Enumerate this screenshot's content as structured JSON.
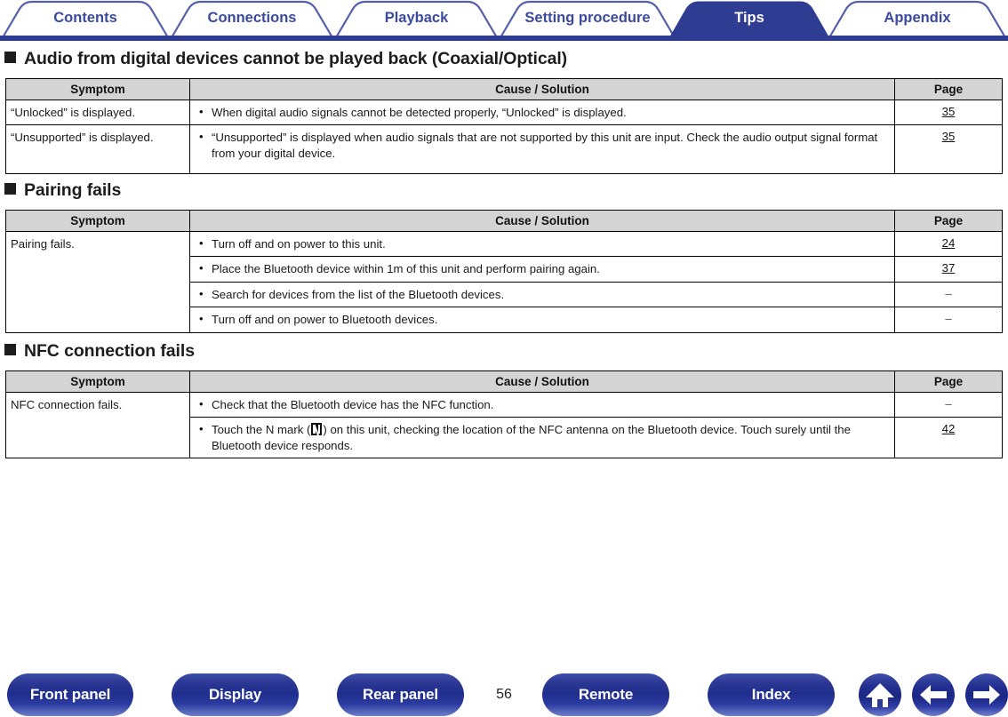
{
  "tabs": [
    {
      "label": "Contents",
      "active": false
    },
    {
      "label": "Connections",
      "active": false
    },
    {
      "label": "Playback",
      "active": false
    },
    {
      "label": "Setting procedure",
      "active": false
    },
    {
      "label": "Tips",
      "active": true
    },
    {
      "label": "Appendix",
      "active": false
    }
  ],
  "columns": {
    "symptom": "Symptom",
    "cause": "Cause / Solution",
    "page": "Page"
  },
  "sections": [
    {
      "heading": "Audio from digital devices cannot be played back (Coaxial/Optical)",
      "rows": [
        {
          "symptom": "“Unlocked” is displayed.",
          "causes": [
            {
              "text": "When digital audio signals cannot be detected properly, “Unlocked” is displayed.",
              "page": "35"
            }
          ]
        },
        {
          "symptom": "“Unsupported” is displayed.",
          "causes": [
            {
              "text": "“Unsupported” is displayed when audio signals that are not supported by this unit are input. Check the audio output signal format from your digital device.",
              "page": "35"
            }
          ]
        }
      ]
    },
    {
      "heading": "Pairing fails",
      "rows": [
        {
          "symptom": "Pairing fails.",
          "causes": [
            {
              "text": "Turn off and on power to this unit.",
              "page": "24"
            },
            {
              "text": "Place the Bluetooth device within 1m of this unit and perform pairing again.",
              "page": "37"
            },
            {
              "text": "Search for devices from the list of the Bluetooth devices.",
              "page": "–"
            },
            {
              "text": "Turn off and on power to Bluetooth devices.",
              "page": "–"
            }
          ]
        }
      ]
    },
    {
      "heading": "NFC connection fails",
      "rows": [
        {
          "symptom": "NFC connection fails.",
          "causes": [
            {
              "text": "Check that the Bluetooth device has the NFC function.",
              "page": "–"
            },
            {
              "text_before_nmark": "Touch the N mark (",
              "text_after_nmark": ") on this unit, checking the location of the NFC antenna on the Bluetooth device. Touch surely until the Bluetooth device responds.",
              "page": "42"
            }
          ]
        }
      ]
    }
  ],
  "footer": {
    "buttons": [
      {
        "label": "Front panel"
      },
      {
        "label": "Display"
      },
      {
        "label": "Rear panel"
      },
      {
        "label": "Remote"
      },
      {
        "label": "Index"
      }
    ],
    "page_number": "56",
    "icons": [
      {
        "name": "home-icon"
      },
      {
        "name": "back-arrow-icon"
      },
      {
        "name": "forward-arrow-icon"
      }
    ]
  },
  "colors": {
    "brand_blue": "#2e3d92",
    "tab_text": "#3b4a9e",
    "header_fill": "#d4d4d4"
  }
}
